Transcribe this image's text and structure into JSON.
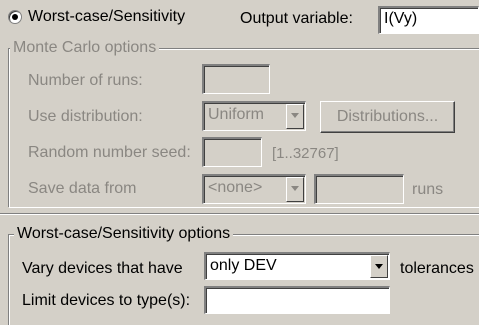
{
  "analysis": {
    "mode_label": "Worst-case/Sensitivity",
    "output_variable_label": "Output variable:",
    "output_variable_value": "I(Vy)"
  },
  "monte_carlo": {
    "title": "Monte Carlo options",
    "runs_label": "Number of runs:",
    "runs_value": "",
    "distribution_label": "Use distribution:",
    "distribution_value": "Uniform",
    "distributions_button": "Distributions...",
    "seed_label": "Random number seed:",
    "seed_value": "",
    "seed_range": "[1..32767]",
    "save_label": "Save data from",
    "save_value": "<none>",
    "save_count": "",
    "runs_suffix": "runs"
  },
  "worst_case": {
    "title": "Worst-case/Sensitivity options",
    "vary_label": "Vary devices that have",
    "vary_value": "only DEV",
    "tolerances_label": "tolerances",
    "limit_label": "Limit devices to type(s):",
    "limit_value": ""
  }
}
